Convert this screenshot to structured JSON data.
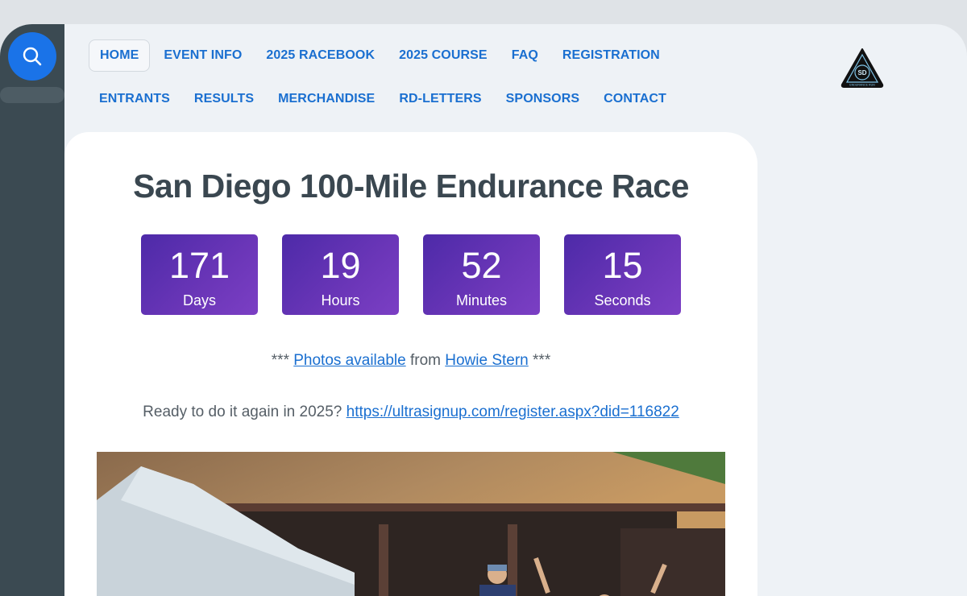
{
  "nav": {
    "row1": [
      "HOME",
      "EVENT INFO",
      "2025 RACEBOOK",
      "2025 COURSE",
      "FAQ",
      "REGISTRATION"
    ],
    "row2": [
      "ENTRANTS",
      "RESULTS",
      "MERCHANDISE",
      "RD-LETTERS",
      "SPONSORS",
      "CONTACT"
    ]
  },
  "logo": {
    "text_top": "SAN DIEGO 100",
    "text_center": "SD",
    "text_bottom": "ENDURANCE RUN"
  },
  "main": {
    "title": "San Diego 100-Mile Endurance Race",
    "countdown": [
      {
        "value": "171",
        "label": "Days"
      },
      {
        "value": "19",
        "label": "Hours"
      },
      {
        "value": "52",
        "label": "Minutes"
      },
      {
        "value": "15",
        "label": "Seconds"
      }
    ],
    "photos": {
      "prefix": "*** ",
      "link1": "Photos available",
      "middle": " from ",
      "link2": "Howie Stern",
      "suffix": " ***"
    },
    "ready": {
      "text": "Ready to do it again in 2025? ",
      "link": "https://ultrasignup.com/register.aspx?did=116822"
    }
  },
  "colors": {
    "link": "#1a6fd0",
    "countdown_bg": "#5b30b0",
    "search_button": "#1a73e8",
    "rail": "#3b4a52"
  }
}
